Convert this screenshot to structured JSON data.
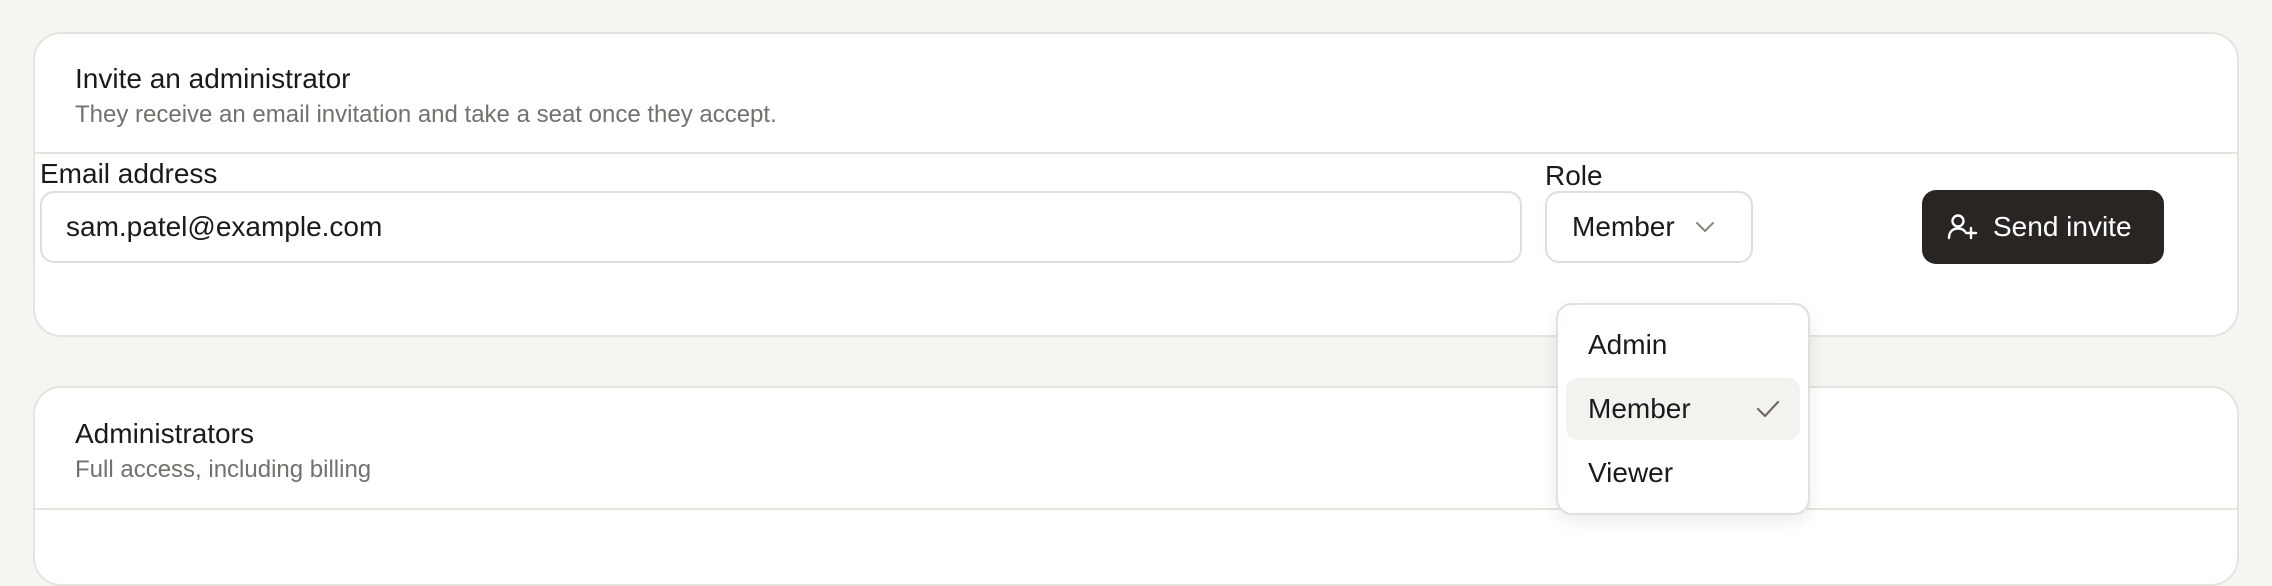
{
  "invite": {
    "title": "Invite an administrator",
    "subtitle": "They receive an email invitation and take a seat once they accept.",
    "email_label": "Email address",
    "email_value": "sam.patel@example.com",
    "role_label": "Role",
    "role_value": "Member",
    "send_label": "Send invite",
    "send_icon": "user-plus-icon"
  },
  "role_menu": {
    "open": true,
    "options": [
      "Admin",
      "Member",
      "Viewer"
    ],
    "selected": "Member"
  },
  "administrators": {
    "title": "Administrators",
    "subtitle": "Full access, including billing"
  },
  "colors": {
    "background": "#f6f5f2",
    "card": "#ffffff",
    "border": "#e6e3de",
    "primary_button": "#282522",
    "muted_text": "#74706b",
    "selected_item": "#f3f2ef"
  }
}
